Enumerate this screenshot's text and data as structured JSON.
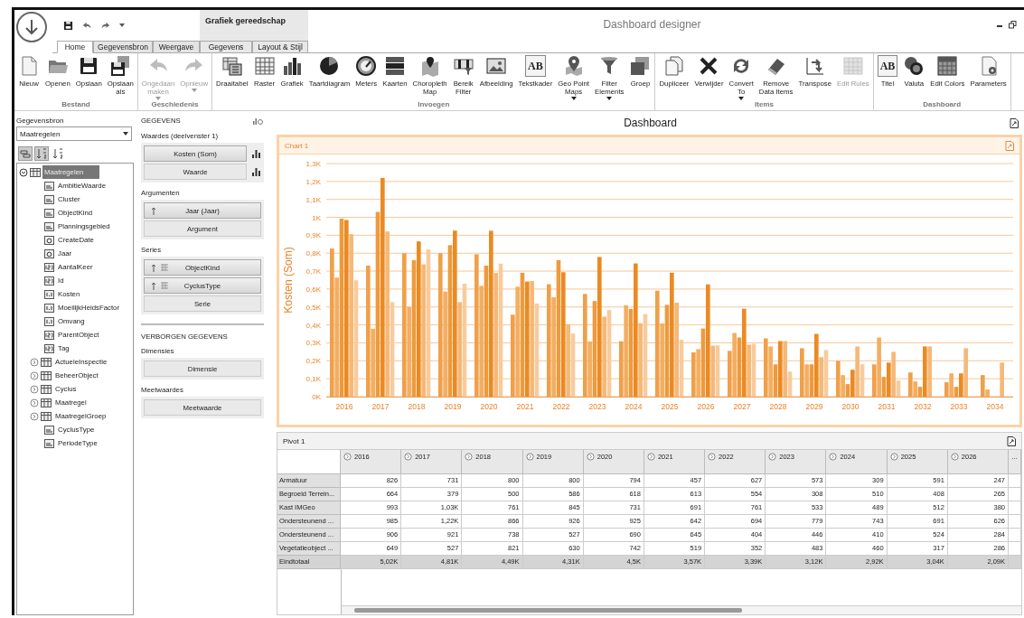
{
  "window": {
    "title": "Dashboard designer",
    "context_tab_header": "Grafiek gereedschap"
  },
  "tabs": [
    {
      "label": "Home",
      "selected": true
    },
    {
      "label": "Gegevensbron",
      "selected": false
    },
    {
      "label": "Weergave",
      "selected": false
    },
    {
      "label": "Gegevens",
      "selected": false
    },
    {
      "label": "Layout & Stijl",
      "selected": false
    }
  ],
  "ribbon": {
    "groups": [
      {
        "label": "Bestand",
        "buttons": [
          {
            "label": "Nieuw",
            "disabled": false,
            "dropdown": false
          },
          {
            "label": "Openen",
            "disabled": false,
            "dropdown": false
          },
          {
            "label": "Opslaan",
            "disabled": false,
            "dropdown": false
          },
          {
            "label": "Opslaan\nals",
            "disabled": false,
            "dropdown": false
          }
        ]
      },
      {
        "label": "Geschiedenis",
        "buttons": [
          {
            "label": "Ongedaan\nmaken",
            "disabled": true,
            "dropdown": true
          },
          {
            "label": "Opnieuw",
            "disabled": true,
            "dropdown": true
          }
        ]
      },
      {
        "label": "Invoegen",
        "buttons": [
          {
            "label": "Draaitabel",
            "disabled": false,
            "dropdown": false
          },
          {
            "label": "Raster",
            "disabled": false,
            "dropdown": false
          },
          {
            "label": "Grafiek",
            "disabled": false,
            "dropdown": false
          },
          {
            "label": "Taartdiagram",
            "disabled": false,
            "dropdown": false
          },
          {
            "label": "Meters",
            "disabled": false,
            "dropdown": false
          },
          {
            "label": "Kaarten",
            "disabled": false,
            "dropdown": false
          },
          {
            "label": "Choropleth\nMap",
            "disabled": false,
            "dropdown": false
          },
          {
            "label": "Bereik\nFilter",
            "disabled": false,
            "dropdown": false
          },
          {
            "label": "Afbeelding",
            "disabled": false,
            "dropdown": false
          },
          {
            "label": "Tekstkader",
            "glyph": "AB",
            "disabled": false,
            "dropdown": false
          },
          {
            "label": "Geo Point\nMaps",
            "disabled": false,
            "dropdown": true
          },
          {
            "label": "Filter\nElements",
            "disabled": false,
            "dropdown": true
          },
          {
            "label": "Groep",
            "disabled": false,
            "dropdown": false
          }
        ]
      },
      {
        "label": "Items",
        "buttons": [
          {
            "label": "Dupliceer",
            "disabled": false,
            "dropdown": false
          },
          {
            "label": "Verwijder",
            "disabled": false,
            "dropdown": false
          },
          {
            "label": "Convert\nTo",
            "disabled": false,
            "dropdown": true
          },
          {
            "label": "Remove\nData Items",
            "disabled": false,
            "dropdown": false
          },
          {
            "label": "Transpose",
            "disabled": false,
            "dropdown": false
          },
          {
            "label": "Edit Rules",
            "disabled": true,
            "dropdown": false
          }
        ]
      },
      {
        "label": "Dashboard",
        "buttons": [
          {
            "label": "Titel",
            "glyph": "AB",
            "disabled": false,
            "dropdown": false
          },
          {
            "label": "Valuta",
            "disabled": false,
            "dropdown": false
          },
          {
            "label": "Edit Colors",
            "disabled": false,
            "dropdown": false
          },
          {
            "label": "Parameters",
            "disabled": false,
            "dropdown": false
          }
        ]
      }
    ]
  },
  "datasource": {
    "label": "Gegevensbron",
    "combo": "Maatregelen",
    "tools": [
      {
        "selected": true
      },
      {
        "selected": true
      },
      {
        "selected": false
      }
    ],
    "tree": [
      {
        "label": "Maatregelen",
        "kind": "table",
        "expanded": true,
        "selected": true,
        "children": [
          {
            "label": "AmbitieWaarde",
            "kind": "text",
            "selected": false
          },
          {
            "label": "Cluster",
            "kind": "text",
            "selected": false
          },
          {
            "label": "ObjectKind",
            "kind": "text",
            "selected": false
          },
          {
            "label": "Planningsgebied",
            "kind": "text",
            "selected": false
          },
          {
            "label": "CreateDate",
            "kind": "date",
            "selected": false
          },
          {
            "label": "Jaar",
            "kind": "date",
            "selected": false
          },
          {
            "label": "AantalKeer",
            "kind": "integer",
            "selected": false
          },
          {
            "label": "Id",
            "kind": "integer",
            "selected": false
          },
          {
            "label": "Kosten",
            "kind": "decimal",
            "selected": false
          },
          {
            "label": "MoeilijkHeidsFactor",
            "kind": "decimal",
            "selected": false
          },
          {
            "label": "Omvang",
            "kind": "decimal",
            "selected": false
          },
          {
            "label": "ParentObject",
            "kind": "integer",
            "selected": false
          },
          {
            "label": "Tag",
            "kind": "integer",
            "selected": false
          },
          {
            "label": "ActueleInspectie",
            "kind": "table",
            "expanded": false,
            "selected": false
          },
          {
            "label": "BeheerObject",
            "kind": "table",
            "expanded": false,
            "selected": false
          },
          {
            "label": "Cyclus",
            "kind": "table",
            "expanded": false,
            "selected": false
          },
          {
            "label": "Maatregel",
            "kind": "table",
            "expanded": false,
            "selected": false
          },
          {
            "label": "MaatregelGroep",
            "kind": "table",
            "expanded": false,
            "selected": false
          },
          {
            "label": "CyclusType",
            "kind": "text",
            "selected": false
          },
          {
            "label": "PeriodeType",
            "kind": "text",
            "selected": false
          }
        ]
      }
    ]
  },
  "data_items": {
    "title": "GEGEVENS",
    "sections": [
      {
        "label": "Waardes (deelvenster 1)",
        "slots": [
          {
            "label": "Kosten (Som)",
            "kind": "measure"
          },
          {
            "label": "Waarde",
            "kind": "measure-empty"
          }
        ]
      },
      {
        "label": "Argumenten",
        "slots": [
          {
            "label": "Jaar (Jaar)",
            "kind": "sorted"
          },
          {
            "label": "Argument",
            "kind": "empty"
          }
        ]
      },
      {
        "label": "Series",
        "slots": [
          {
            "label": "ObjectKind",
            "kind": "sorted-grid"
          },
          {
            "label": "CyclusType",
            "kind": "sorted-grid"
          },
          {
            "label": "Serie",
            "kind": "empty"
          }
        ]
      }
    ],
    "hidden_title": "VERBORGEN GEGEVENS",
    "hidden_sections": [
      {
        "label": "Dimensies",
        "slots": [
          {
            "label": "Dimensie",
            "kind": "empty"
          }
        ]
      },
      {
        "label": "Meetwaardes",
        "slots": [
          {
            "label": "Meetwaarde",
            "kind": "empty"
          }
        ]
      }
    ]
  },
  "dashboard": {
    "title": "Dashboard",
    "chart": {
      "title": "Chart 1",
      "selected": true,
      "chart_data": {
        "type": "bar",
        "ylabel": "Kosten (Som)",
        "grid": true,
        "categories": [
          "2016",
          "2017",
          "2018",
          "2019",
          "2020",
          "2021",
          "2022",
          "2023",
          "2024",
          "2025",
          "2026",
          "2027",
          "2028",
          "2029",
          "2030",
          "2031",
          "2032",
          "2033",
          "2034"
        ],
        "series": [
          {
            "color": "#f0a04a",
            "values": [
              826,
              731,
              800,
              800,
              794,
              457,
              627,
              573,
              309,
              591,
              247,
              255,
              325,
              270,
              200,
              180,
              135,
              80,
              120
            ]
          },
          {
            "color": "#f3ae62",
            "values": [
              664,
              379,
              500,
              586,
              618,
              613,
              554,
              308,
              510,
              408,
              265,
              355,
              280,
              180,
              120,
              330,
              85,
              130,
              40
            ]
          },
          {
            "color": "#ee9a3c",
            "values": [
              993,
              1030,
              761,
              845,
              731,
              691,
              761,
              533,
              489,
              512,
              380,
              330,
              180,
              180,
              70,
              110,
              55,
              55,
              null
            ]
          },
          {
            "color": "#eb8a22",
            "values": [
              985,
              1220,
              866,
              926,
              925,
              642,
              694,
              779,
              743,
              691,
              626,
              490,
              310,
              350,
              150,
              190,
              280,
              130,
              null
            ]
          },
          {
            "color": "#f5b877",
            "values": [
              906,
              921,
              738,
              527,
              690,
              645,
              404,
              446,
              410,
              524,
              284,
              290,
              310,
              220,
              280,
              250,
              280,
              270,
              190
            ]
          },
          {
            "color": "#f8cb9c",
            "values": [
              649,
              527,
              821,
              630,
              742,
              519,
              352,
              483,
              460,
              317,
              286,
              295,
              140,
              260,
              180,
              90,
              null,
              null,
              null
            ]
          }
        ],
        "ylim": [
          0,
          1300
        ],
        "yticks": [
          {
            "value": 0,
            "label": "0K"
          },
          {
            "value": 100,
            "label": "0,1K"
          },
          {
            "value": 200,
            "label": "0,2K"
          },
          {
            "value": 300,
            "label": "0,3K"
          },
          {
            "value": 400,
            "label": "0,4K"
          },
          {
            "value": 500,
            "label": "0,5K"
          },
          {
            "value": 600,
            "label": "0,6K"
          },
          {
            "value": 700,
            "label": "0,7K"
          },
          {
            "value": 800,
            "label": "0,8K"
          },
          {
            "value": 900,
            "label": "0,9K"
          },
          {
            "value": 1000,
            "label": "1K"
          },
          {
            "value": 1100,
            "label": "1,1K"
          },
          {
            "value": 1200,
            "label": "1,2K"
          },
          {
            "value": 1300,
            "label": "1,3K"
          }
        ]
      }
    },
    "pivot": {
      "title": "Pivot 1",
      "columns": [
        "2016",
        "2017",
        "2018",
        "2019",
        "2020",
        "2021",
        "2022",
        "2023",
        "2024",
        "2025",
        "2026"
      ],
      "more": "...",
      "rows": [
        {
          "label": "Armatuur",
          "cells": [
            "826",
            "731",
            "800",
            "800",
            "794",
            "457",
            "627",
            "573",
            "309",
            "591",
            "247"
          ]
        },
        {
          "label": "Begroeid Terrein...",
          "cells": [
            "664",
            "379",
            "500",
            "586",
            "618",
            "613",
            "554",
            "308",
            "510",
            "408",
            "265"
          ]
        },
        {
          "label": "Kast IMGeo",
          "cells": [
            "993",
            "1,03K",
            "761",
            "845",
            "731",
            "691",
            "761",
            "533",
            "489",
            "512",
            "380"
          ]
        },
        {
          "label": "Ondersteunend ...",
          "cells": [
            "985",
            "1,22K",
            "866",
            "926",
            "925",
            "642",
            "694",
            "779",
            "743",
            "691",
            "626"
          ]
        },
        {
          "label": "Ondersteunend ...",
          "cells": [
            "906",
            "921",
            "738",
            "527",
            "690",
            "645",
            "404",
            "446",
            "410",
            "524",
            "284"
          ]
        },
        {
          "label": "Vegetatieobject ...",
          "cells": [
            "649",
            "527",
            "821",
            "630",
            "742",
            "519",
            "352",
            "483",
            "460",
            "317",
            "286"
          ]
        }
      ],
      "total": {
        "label": "Eindtotaal",
        "cells": [
          "5,02K",
          "4,81K",
          "4,49K",
          "4,31K",
          "4,5K",
          "3,57K",
          "3,39K",
          "3,12K",
          "2,92K",
          "3,04K",
          "2,09K"
        ]
      }
    }
  }
}
